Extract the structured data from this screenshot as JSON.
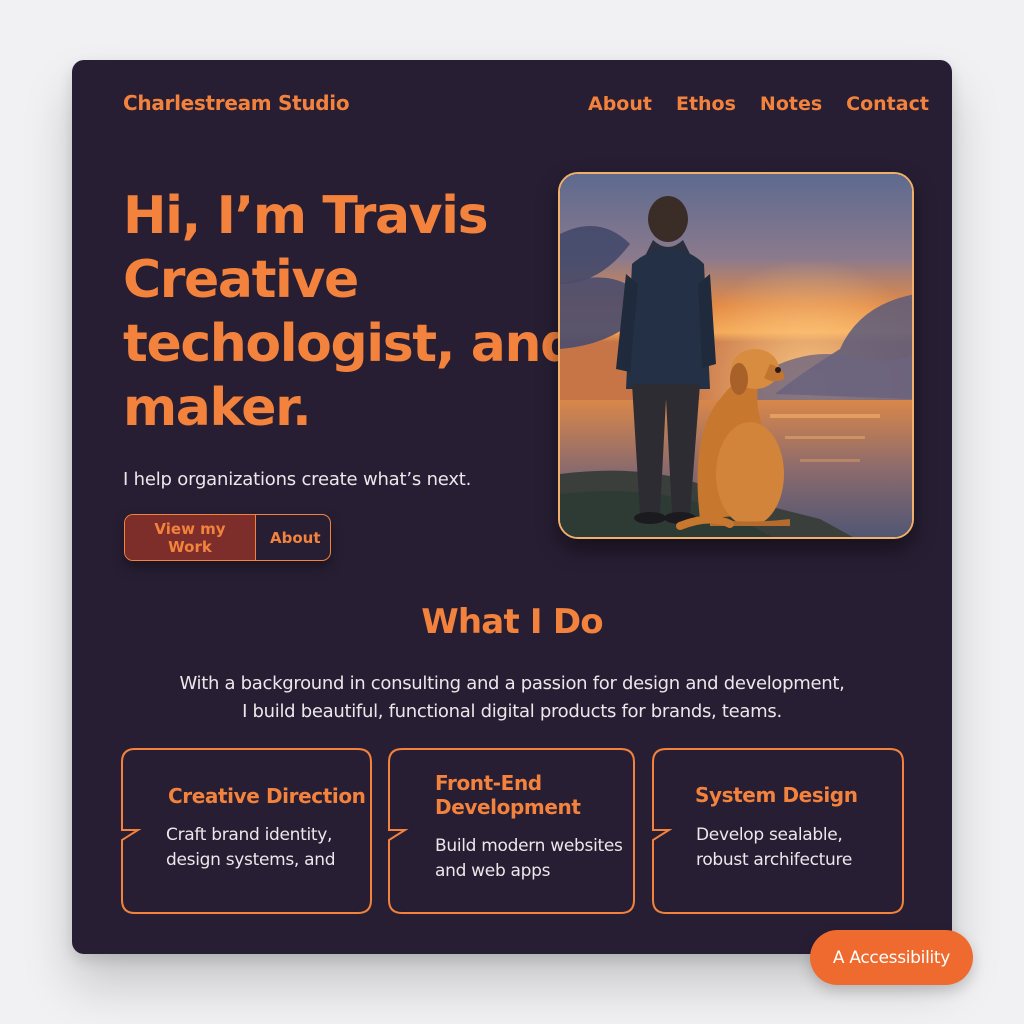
{
  "header": {
    "brand": "Charlestream Studio",
    "nav": [
      "About",
      "Ethos",
      "Notes",
      "Contact"
    ]
  },
  "hero": {
    "title_lines": [
      "Hi, I’m Travis",
      "Creative",
      "techologist, and",
      "maker."
    ],
    "subtitle": "I help organizations create what’s next.",
    "primary_button": "View my Work",
    "secondary_button": "About"
  },
  "what_i_do": {
    "title": "What I Do",
    "description_lines": [
      "With a background in consulting and a passion for design and development,",
      "I build beautiful, functional digital products for brands, teams."
    ],
    "services": [
      {
        "title_lines": [
          "Creative Direction"
        ],
        "text_lines": [
          "Craft brand identity,",
          "design systems, and"
        ]
      },
      {
        "title_lines": [
          "Front-End",
          "Development"
        ],
        "text_lines": [
          "Build modern websites",
          "and web apps"
        ]
      },
      {
        "title_lines": [
          "System Design"
        ],
        "text_lines": [
          "Develop sealable,",
          "robust archifecture"
        ]
      }
    ]
  },
  "accessibility_button": "A Accessibility",
  "colors": {
    "background": "#271e33",
    "accent": "#f3823d",
    "text": "#ece7ea",
    "button_fill": "#7d2e2b",
    "accessibility_button": "#ee6a2e"
  }
}
